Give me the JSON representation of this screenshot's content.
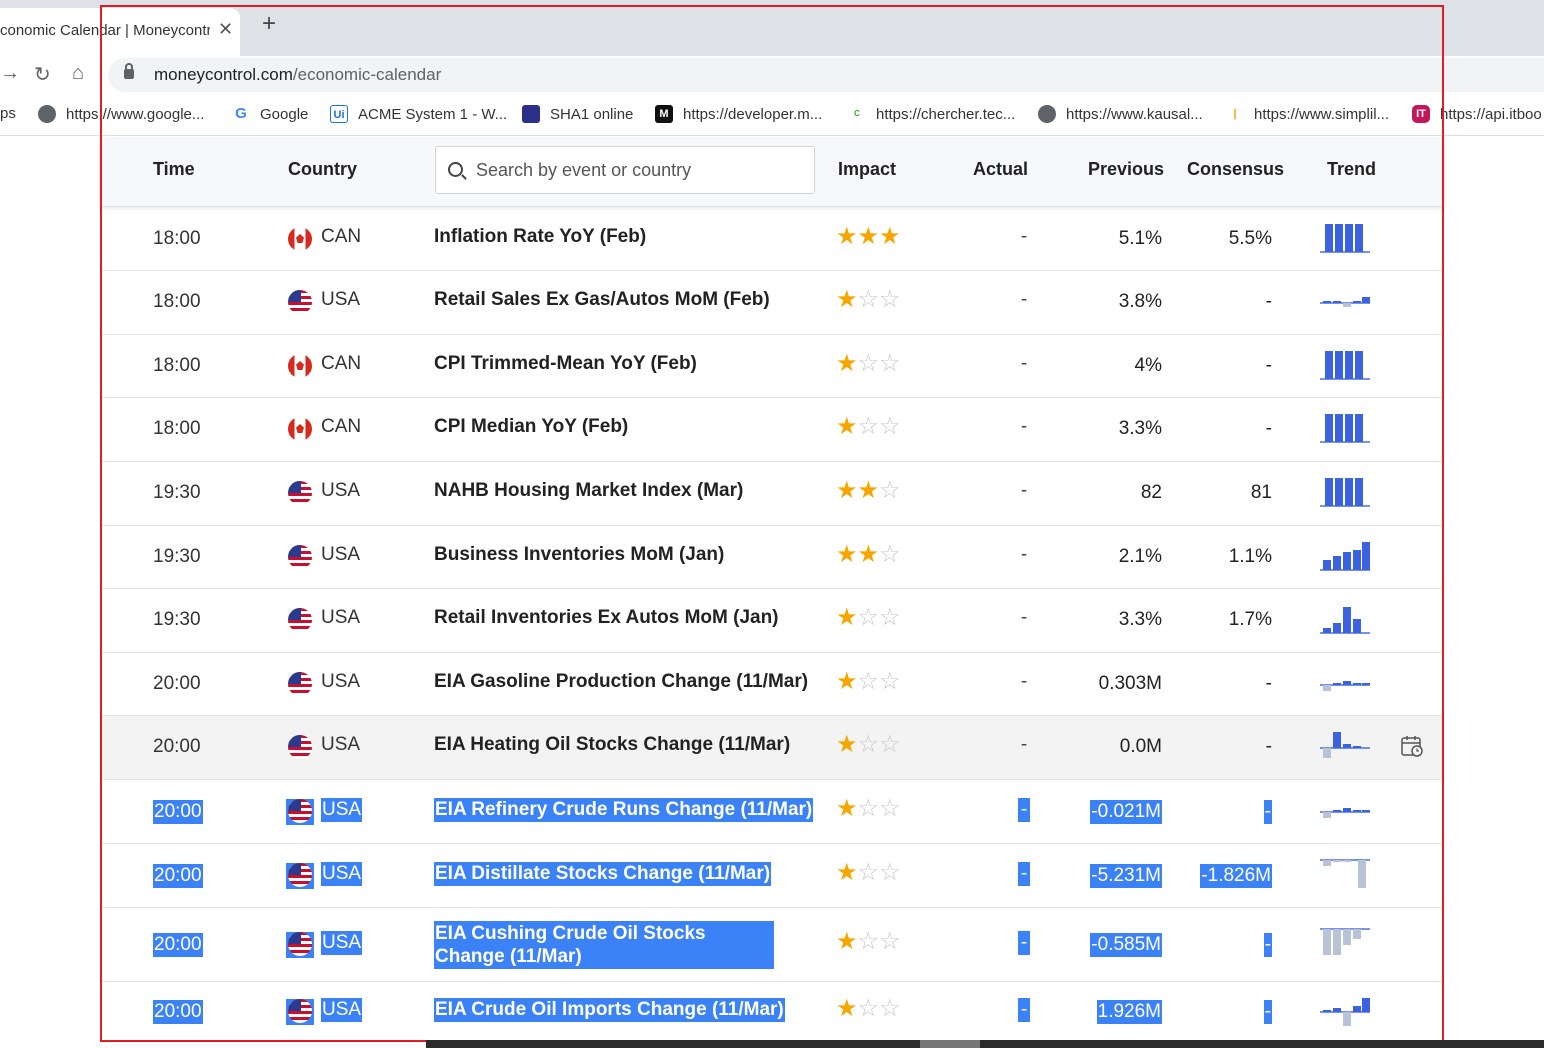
{
  "browser": {
    "tab_title": "conomic Calendar | Moneycontr",
    "new_tab_label": "+",
    "close_label": "✕",
    "url_host": "moneycontrol.com",
    "url_path": "/economic-calendar"
  },
  "bookmarks": [
    {
      "label": "ps"
    },
    {
      "label": "https://www.google..."
    },
    {
      "label": "Google"
    },
    {
      "label": "ACME System 1 - W..."
    },
    {
      "label": "SHA1 online"
    },
    {
      "label": "https://developer.m..."
    },
    {
      "label": "https://chercher.tec..."
    },
    {
      "label": "https://www.kausal..."
    },
    {
      "label": "https://www.simplil..."
    },
    {
      "label": "https://api.itboo"
    }
  ],
  "header": {
    "time": "Time",
    "country": "Country",
    "search_placeholder": "Search by event or country",
    "impact": "Impact",
    "actual": "Actual",
    "previous": "Previous",
    "consensus": "Consensus",
    "trend": "Trend"
  },
  "accent_color": "#3b82f6",
  "star_color": "#f7a600",
  "rows": [
    {
      "time": "18:00",
      "flag": "can",
      "country": "CAN",
      "event": "Inflation Rate YoY (Feb)",
      "impact": 3,
      "actual": "-",
      "previous": "5.1%",
      "consensus": "5.5%",
      "trend": "up-bars"
    },
    {
      "time": "18:00",
      "flag": "usa",
      "country": "USA",
      "event": "Retail Sales Ex Gas/Autos MoM (Feb)",
      "impact": 1,
      "actual": "-",
      "previous": "3.8%",
      "consensus": "-",
      "trend": "flat-mixed"
    },
    {
      "time": "18:00",
      "flag": "can",
      "country": "CAN",
      "event": "CPI Trimmed-Mean YoY (Feb)",
      "impact": 1,
      "actual": "-",
      "previous": "4%",
      "consensus": "-",
      "trend": "up-bars"
    },
    {
      "time": "18:00",
      "flag": "can",
      "country": "CAN",
      "event": "CPI Median YoY (Feb)",
      "impact": 1,
      "actual": "-",
      "previous": "3.3%",
      "consensus": "-",
      "trend": "up-bars"
    },
    {
      "time": "19:30",
      "flag": "usa",
      "country": "USA",
      "event": "NAHB Housing Market Index (Mar)",
      "impact": 2,
      "actual": "-",
      "previous": "82",
      "consensus": "81",
      "trend": "up-bars"
    },
    {
      "time": "19:30",
      "flag": "usa",
      "country": "USA",
      "event": "Business Inventories MoM (Jan)",
      "impact": 2,
      "actual": "-",
      "previous": "2.1%",
      "consensus": "1.1%",
      "trend": "rising"
    },
    {
      "time": "19:30",
      "flag": "usa",
      "country": "USA",
      "event": "Retail Inventories Ex Autos MoM (Jan)",
      "impact": 1,
      "actual": "-",
      "previous": "3.3%",
      "consensus": "1.7%",
      "trend": "peak"
    },
    {
      "time": "20:00",
      "flag": "usa",
      "country": "USA",
      "event": "EIA Gasoline Production Change (11/Mar)",
      "impact": 1,
      "actual": "-",
      "previous": "0.303M",
      "consensus": "-",
      "trend": "small"
    },
    {
      "time": "20:00",
      "flag": "usa",
      "country": "USA",
      "event": "EIA Heating Oil Stocks Change (11/Mar)",
      "impact": 1,
      "actual": "-",
      "previous": "0.0M",
      "consensus": "-",
      "trend": "mixed"
    },
    {
      "time": "20:00",
      "flag": "usa",
      "country": "USA",
      "event": "EIA Refinery Crude Runs Change (11/Mar)",
      "impact": 1,
      "actual": "-",
      "previous": "-0.021M",
      "consensus": "-",
      "trend": "small"
    },
    {
      "time": "20:00",
      "flag": "usa",
      "country": "USA",
      "event": "EIA Distillate Stocks Change (11/Mar)",
      "impact": 1,
      "actual": "-",
      "previous": "-5.231M",
      "consensus": "-1.826M",
      "trend": "down"
    },
    {
      "time": "20:00",
      "flag": "usa",
      "country": "USA",
      "event": "EIA Cushing Crude Oil Stocks Change (11/Mar)",
      "impact": 1,
      "actual": "-",
      "previous": "-0.585M",
      "consensus": "-",
      "trend": "neg-bars"
    },
    {
      "time": "20:00",
      "flag": "usa",
      "country": "USA",
      "event": "EIA Crude Oil Imports Change (11/Mar)",
      "impact": 1,
      "actual": "-",
      "previous": "1.926M",
      "consensus": "-",
      "trend": "mixed2"
    }
  ]
}
